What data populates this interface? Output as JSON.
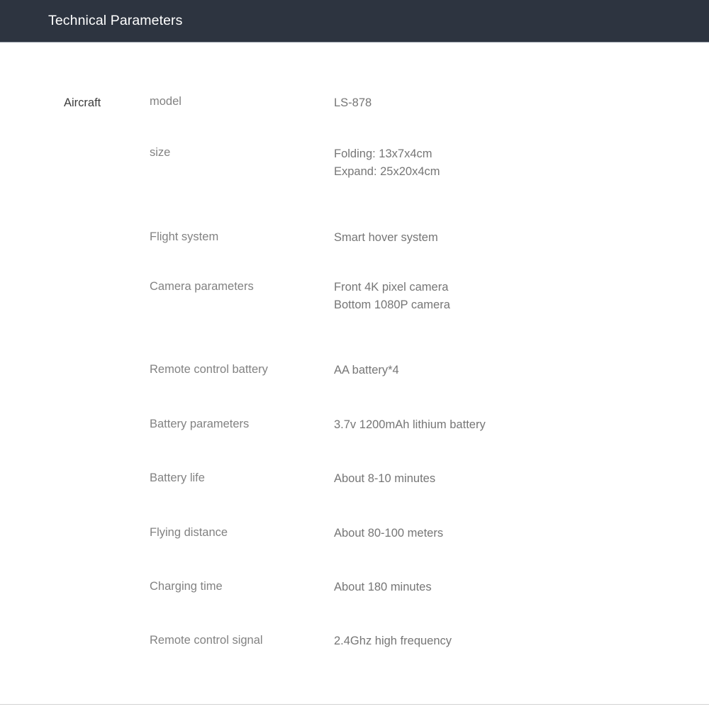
{
  "header": {
    "title": "Technical Parameters",
    "background_color": "#2d3440",
    "text_color": "#ffffff"
  },
  "colors": {
    "page_background": "#ffffff",
    "group_label": "#3c3c3c",
    "param_name": "#828282",
    "param_value": "#767676",
    "bottom_rule": "#d2d2d2"
  },
  "spec_table": {
    "group_label": "Aircraft",
    "rows": [
      {
        "name": "model",
        "value": "LS-878"
      },
      {
        "name": "size",
        "value": "Folding: 13x7x4cm\nExpand: 25x20x4cm"
      },
      {
        "name": "Flight system",
        "value": "Smart hover system"
      },
      {
        "name": "Camera parameters",
        "value": "Front 4K pixel camera\nBottom 1080P camera"
      },
      {
        "name": "Remote control battery",
        "value": "AA battery*4"
      },
      {
        "name": "Battery parameters",
        "value": "3.7v 1200mAh lithium battery"
      },
      {
        "name": "Battery life",
        "value": "About 8-10 minutes"
      },
      {
        "name": "Flying distance",
        "value": "About 80-100 meters"
      },
      {
        "name": "Charging time",
        "value": "About 180 minutes"
      },
      {
        "name": "Remote control signal",
        "value": "2.4Ghz high frequency"
      }
    ]
  }
}
